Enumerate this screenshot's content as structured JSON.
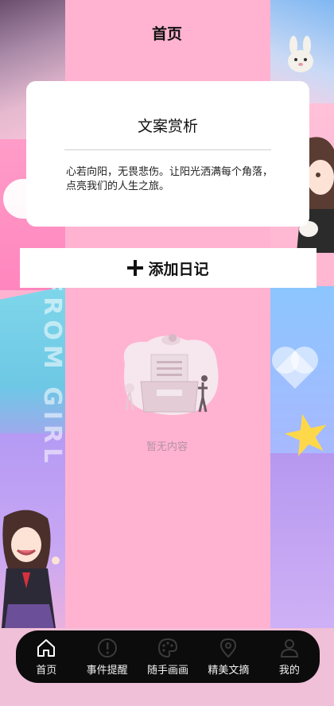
{
  "header": {
    "title": "首页"
  },
  "card": {
    "title": "文案赏析",
    "text": "心若向阳，无畏悲伤。让阳光洒满每个角落，点亮我们的人生之旅。"
  },
  "add_button": {
    "label": "添加日记",
    "icon": "plus-icon"
  },
  "empty_state": {
    "text": "暂无内容",
    "icon": "empty-inbox-illustration"
  },
  "background": {
    "watermark": "FROM GIRL"
  },
  "tabbar": {
    "items": [
      {
        "label": "首页",
        "icon": "home-icon",
        "active": true
      },
      {
        "label": "事件提醒",
        "icon": "alert-circle-icon",
        "active": false
      },
      {
        "label": "随手画画",
        "icon": "palette-icon",
        "active": false
      },
      {
        "label": "精美文摘",
        "icon": "location-pin-icon",
        "active": false
      },
      {
        "label": "我的",
        "icon": "user-icon",
        "active": false
      }
    ]
  },
  "colors": {
    "background": "#ffb3d1",
    "card": "#ffffff",
    "tabbar": "#0c0c0c",
    "empty_text": "#b493a4"
  }
}
